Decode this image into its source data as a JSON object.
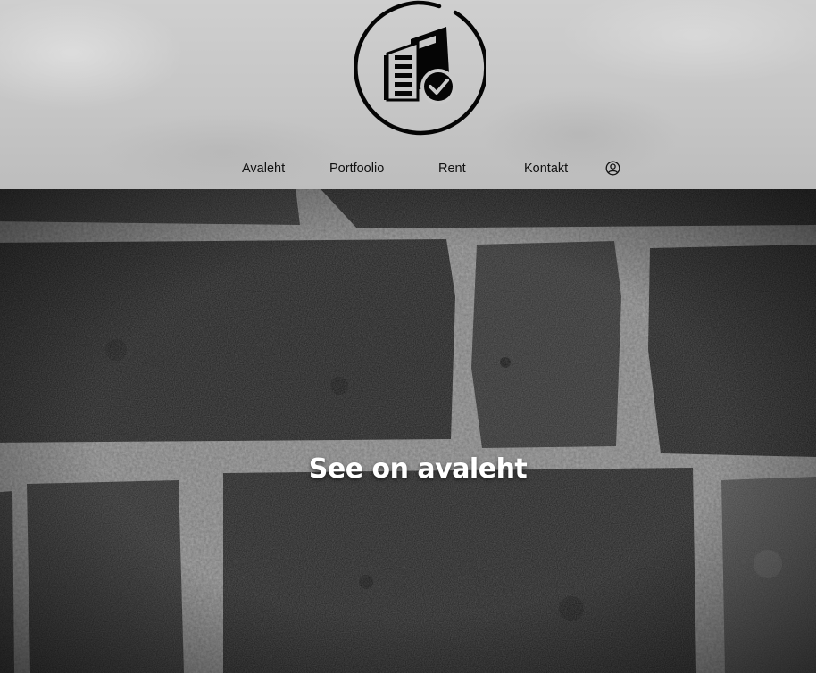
{
  "header": {
    "logo_icon": "building-check-logo-icon"
  },
  "nav": {
    "items": [
      {
        "label": "Avaleht"
      },
      {
        "label": "Portfoolio"
      },
      {
        "label": "Rent"
      },
      {
        "label": "Kontakt"
      }
    ],
    "account_icon": "user-circle-icon"
  },
  "hero": {
    "title": "See on avaleht",
    "background": "dark-brick-wall"
  },
  "colors": {
    "header_bg": "#c8c8c8",
    "nav_text": "#111111",
    "hero_bg": "#2a2a2a",
    "hero_text": "#ffffff"
  }
}
